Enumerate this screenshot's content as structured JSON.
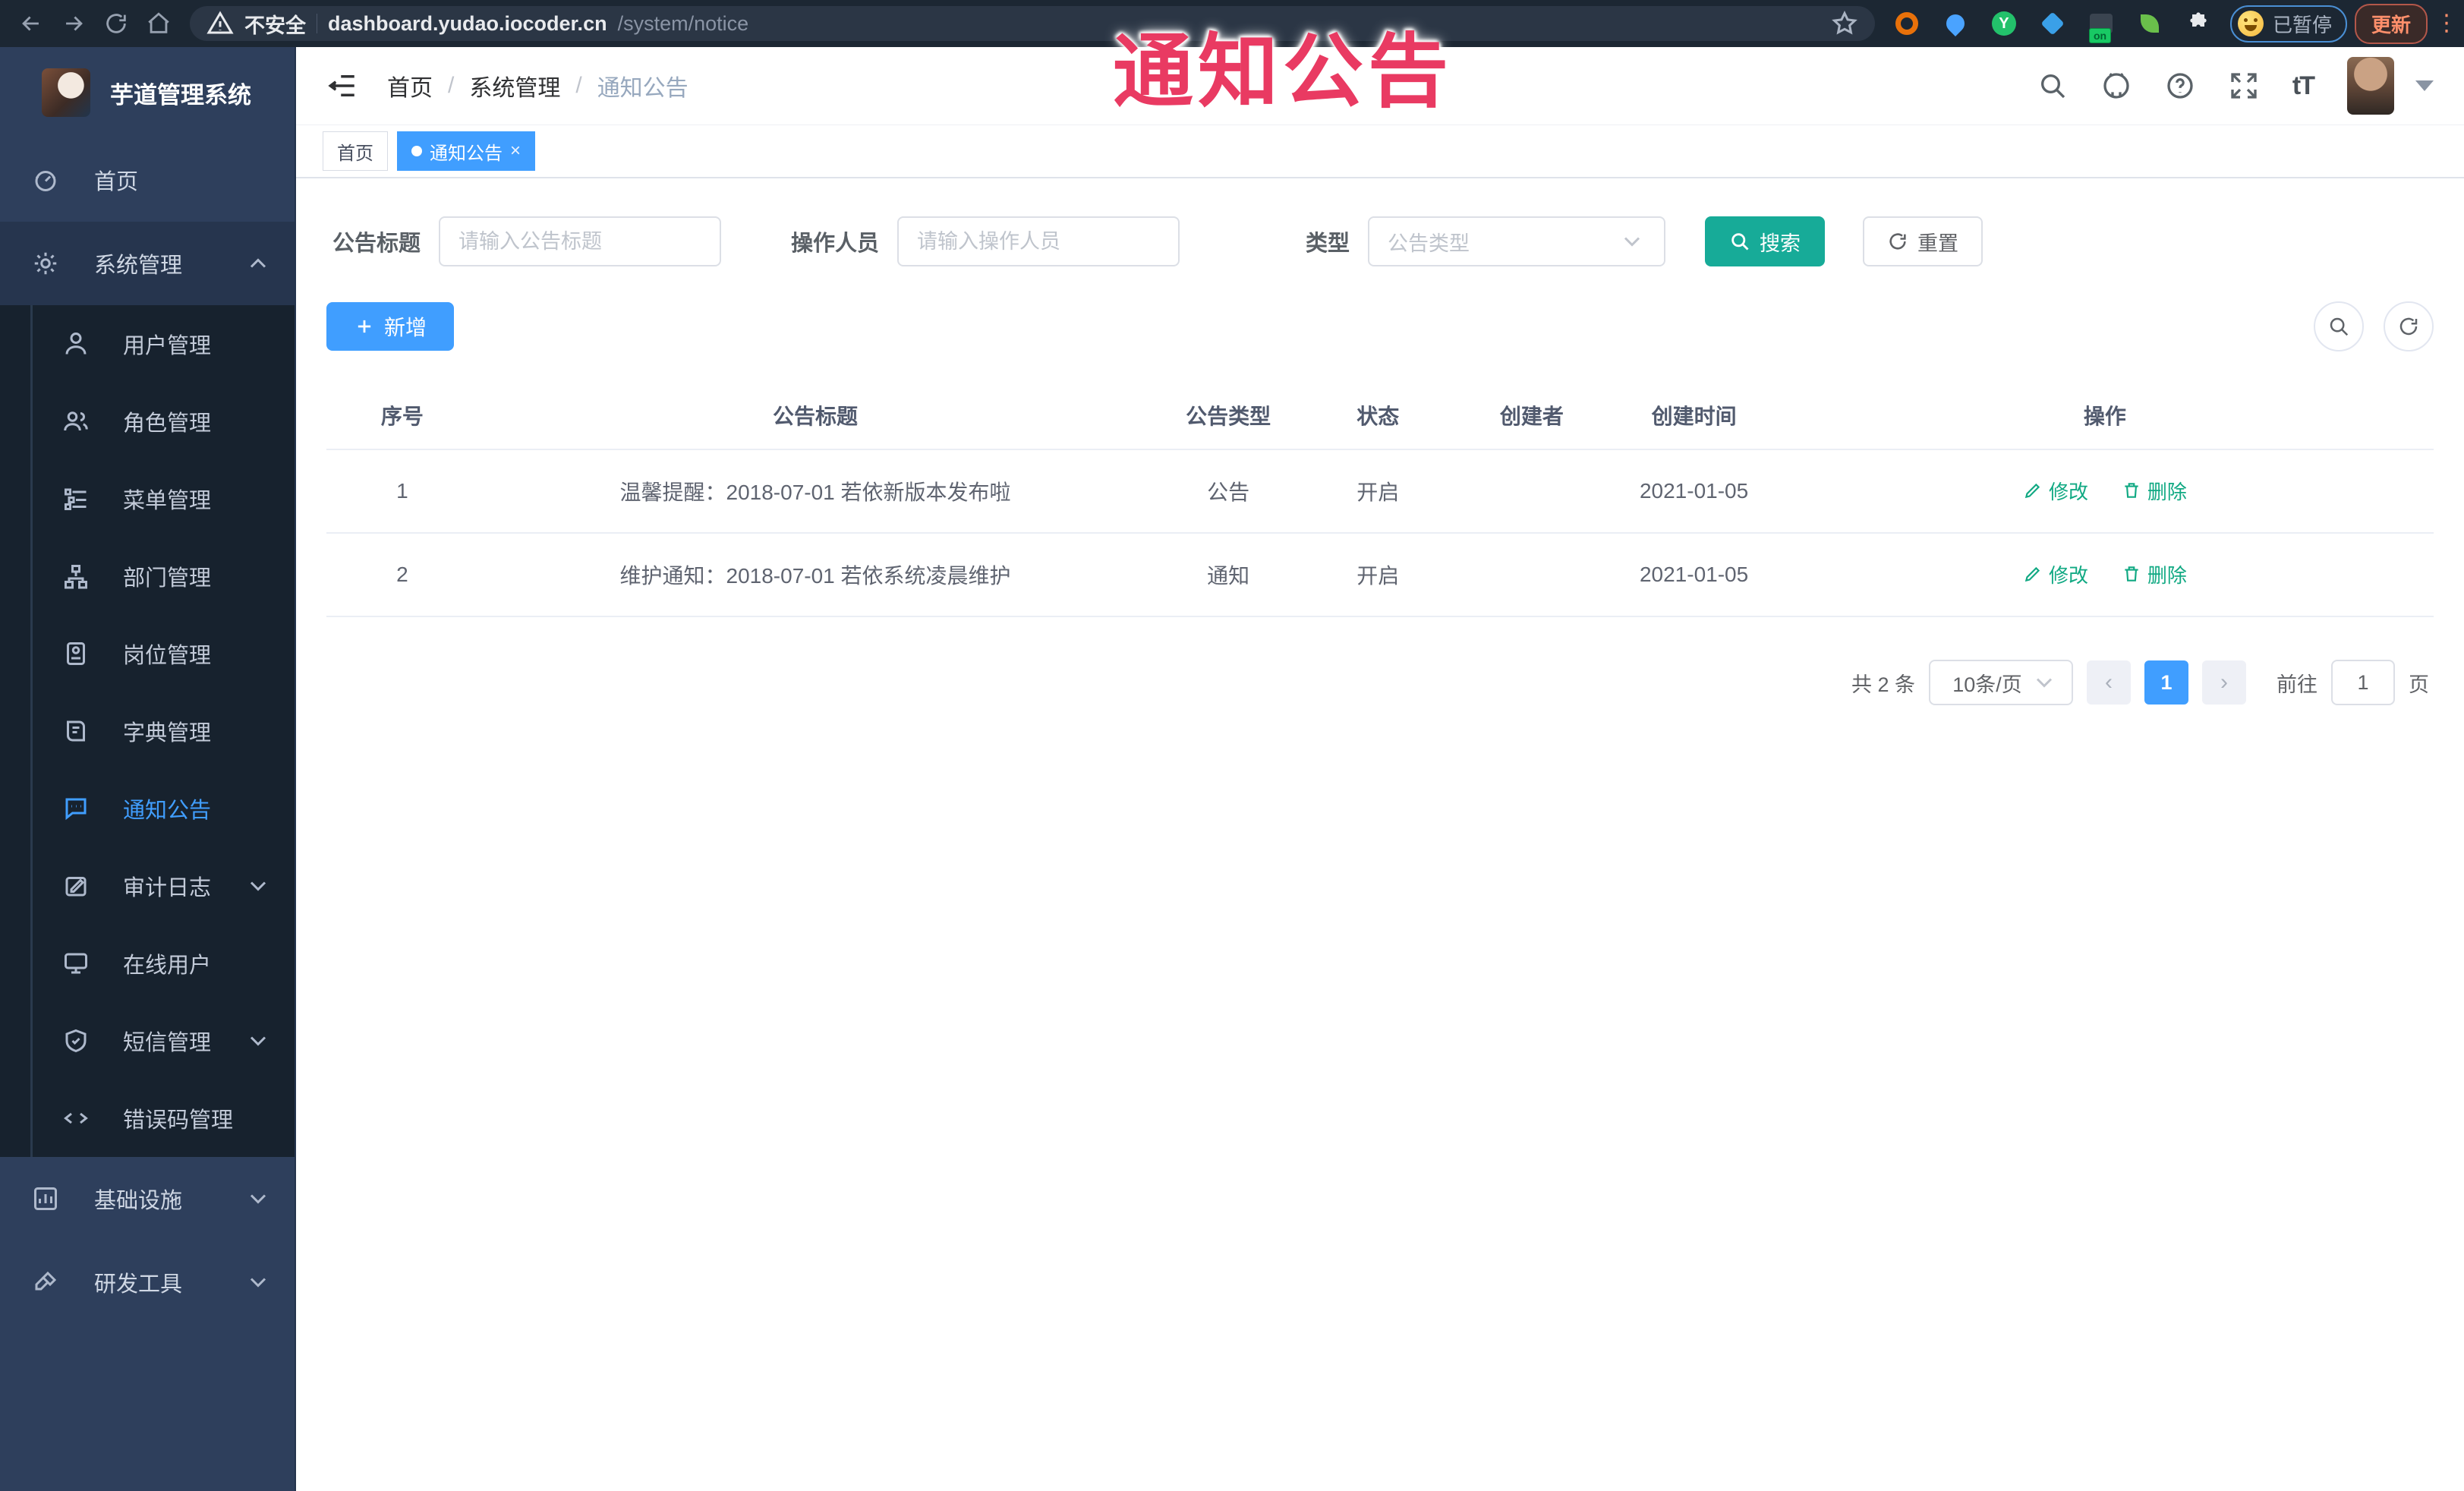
{
  "browser": {
    "security_label": "不安全",
    "url_host": "dashboard.yudao.iocoder.cn",
    "url_path": "/system/notice",
    "ext_green_letter": "Y",
    "ext_badge": "on",
    "paused_label": "已暂停",
    "update_label": "更新",
    "menu_dots": "⋮"
  },
  "watermark": {
    "text": "通知公告",
    "color": "#e93a62"
  },
  "sidebar": {
    "title": "芋道管理系统",
    "home": {
      "label": "首页"
    },
    "system": {
      "label": "系统管理"
    },
    "submenu": [
      {
        "label": "用户管理"
      },
      {
        "label": "角色管理"
      },
      {
        "label": "菜单管理"
      },
      {
        "label": "部门管理"
      },
      {
        "label": "岗位管理"
      },
      {
        "label": "字典管理"
      },
      {
        "label": "通知公告"
      },
      {
        "label": "审计日志"
      },
      {
        "label": "在线用户"
      },
      {
        "label": "短信管理"
      },
      {
        "label": "错误码管理"
      }
    ],
    "bottom": [
      {
        "label": "基础设施"
      },
      {
        "label": "研发工具"
      }
    ]
  },
  "nav": {
    "breadcrumb": {
      "home": "首页",
      "section": "系统管理",
      "current": "通知公告"
    }
  },
  "tabs": {
    "home": "首页",
    "current": "通知公告"
  },
  "filters": {
    "title_label": "公告标题",
    "title_placeholder": "请输入公告标题",
    "operator_label": "操作人员",
    "operator_placeholder": "请输入操作人员",
    "type_label": "类型",
    "type_placeholder": "公告类型",
    "search_label": "搜索",
    "reset_label": "重置"
  },
  "toolbar": {
    "add_label": "新增"
  },
  "table": {
    "columns": [
      "序号",
      "公告标题",
      "公告类型",
      "状态",
      "创建者",
      "创建时间",
      "操作"
    ],
    "rows": [
      {
        "id": "1",
        "title": "温馨提醒：2018-07-01 若依新版本发布啦",
        "type": "公告",
        "status": "开启",
        "creator": "",
        "created": "2021-01-05"
      },
      {
        "id": "2",
        "title": "维护通知：2018-07-01 若依系统凌晨维护",
        "type": "通知",
        "status": "开启",
        "creator": "",
        "created": "2021-01-05"
      }
    ],
    "edit_label": "修改",
    "delete_label": "删除"
  },
  "pagination": {
    "total_text": "共 2 条",
    "page_size": "10条/页",
    "prev": "‹",
    "current_page": "1",
    "next": "›",
    "goto_label": "前往",
    "goto_value": "1",
    "page_unit": "页"
  },
  "colors": {
    "accent_blue": "#409eff",
    "search_teal": "#17ab98",
    "action_green": "#11A983",
    "sidebar_bg": "#2e3f5c",
    "submenu_bg": "#17222e",
    "browser_bar_bg": "#1c2733",
    "watermark_pink": "#e93a62"
  }
}
